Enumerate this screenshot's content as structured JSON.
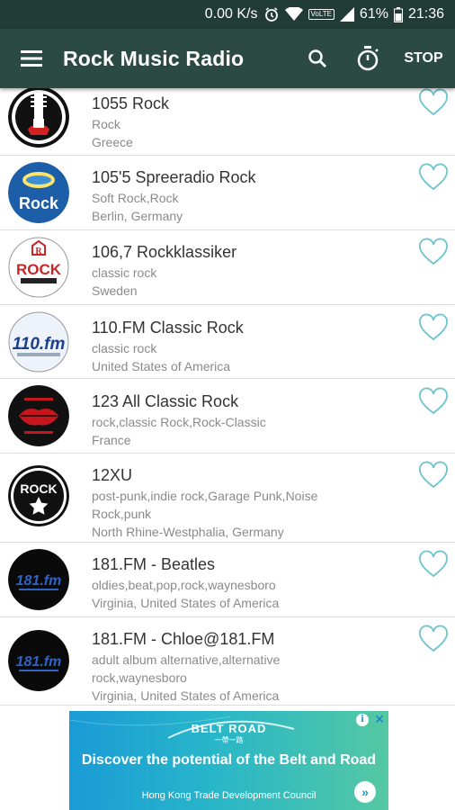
{
  "status_bar": {
    "speed": "0.00 K/s",
    "network_badge": "VoLTE",
    "battery": "61%",
    "time": "21:36",
    "icons": [
      "alarm-icon",
      "wifi-icon",
      "signal-icon",
      "battery-icon"
    ]
  },
  "app_bar": {
    "title": "Rock Music Radio",
    "stop_label": "STOP",
    "icons": [
      "menu-icon",
      "search-icon",
      "timer-icon"
    ]
  },
  "colors": {
    "toolbar": "#2b4a44",
    "status_bar": "#213b36",
    "heart": "#6fc4cf",
    "divider": "#dcdcdc"
  },
  "stations": [
    {
      "title": "1055 Rock",
      "genre": "Rock",
      "location": "Greece",
      "logo": "guitar-logo"
    },
    {
      "title": "105'5 Spreeradio Rock",
      "genre": "Soft Rock,Rock",
      "location": "Berlin, Germany",
      "logo": "spreeradio-logo",
      "logo_text": "Rock"
    },
    {
      "title": "106,7 Rockklassiker",
      "genre": "classic rock",
      "location": "Sweden",
      "logo": "rockklassiker-logo",
      "logo_text": "ROCK"
    },
    {
      "title": "110.FM Classic Rock",
      "genre": "classic rock",
      "location": "United States of America",
      "logo": "110fm-logo",
      "logo_text": "110.fm"
    },
    {
      "title": "123 All Classic Rock",
      "genre": "rock,classic Rock,Rock-Classic",
      "location": "France",
      "logo": "lips-logo"
    },
    {
      "title": "12XU",
      "genre": "post-punk,indie rock,Garage Punk,Noise Rock,punk",
      "location": "North Rhine-Westphalia, Germany",
      "logo": "rock-star-logo",
      "logo_text": "ROCK"
    },
    {
      "title": "181.FM - Beatles",
      "genre": "oldies,beat,pop,rock,waynesboro",
      "location": "Virginia, United States of America",
      "logo": "181fm-logo",
      "logo_text": "181.fm"
    },
    {
      "title": "181.FM - Chloe@181.FM",
      "genre": "adult album alternative,alternative rock,waynesboro",
      "location": "Virginia, United States of America",
      "logo": "181fm-logo",
      "logo_text": "181.fm"
    }
  ],
  "ad": {
    "brand": "BELT ROAD",
    "brand_sub": "一帶一路",
    "headline": "Discover the potential of the Belt and Road",
    "footer": "Hong Kong Trade Development Council",
    "info_glyph": "i",
    "close_glyph": "✕",
    "arrow_glyph": "»"
  }
}
